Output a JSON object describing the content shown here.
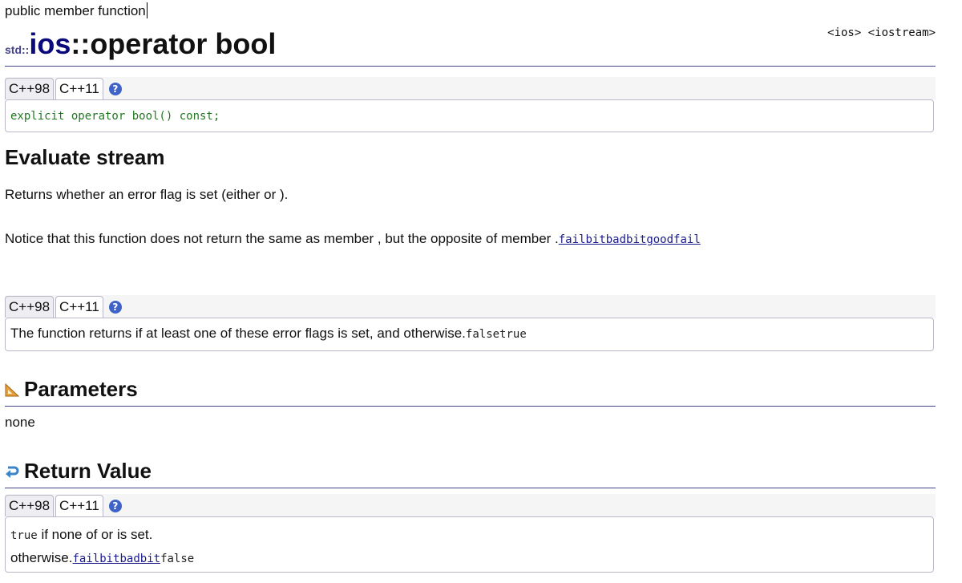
{
  "page": {
    "kind_label": "public member function",
    "headers": "<ios> <iostream>",
    "title_ns": "std::",
    "title_class": "ios",
    "title_member": "::operator bool"
  },
  "version_tabs": {
    "cpp98": "C++98",
    "cpp11": "C++11",
    "help": "?"
  },
  "prototype": {
    "code": "explicit operator bool() const;"
  },
  "description": {
    "heading": "Evaluate stream",
    "line1": "Returns whether an error flag is set (either or ).",
    "line2_text": "Notice that this function does not return the same as member , but the opposite of member .",
    "line2_link": "failbitbadbitgoodfail",
    "box_text": "The function returns if at least one of these error flags is set, and otherwise.",
    "box_code": "falsetrue"
  },
  "parameters": {
    "heading": "Parameters",
    "text": "none",
    "icon": "ruler-triangle-icon"
  },
  "return_value": {
    "heading": "Return Value",
    "icon": "return-arrow-icon",
    "line1_code": "true",
    "line1_text": " if none of or is set.",
    "line2_text": "otherwise.",
    "line2_link": "failbitbadbit",
    "line2_code": "false"
  },
  "colors": {
    "accent": "#0a0a7a",
    "code_green": "#227722",
    "rule": "#444488",
    "help_blue": "#3e63c8"
  }
}
